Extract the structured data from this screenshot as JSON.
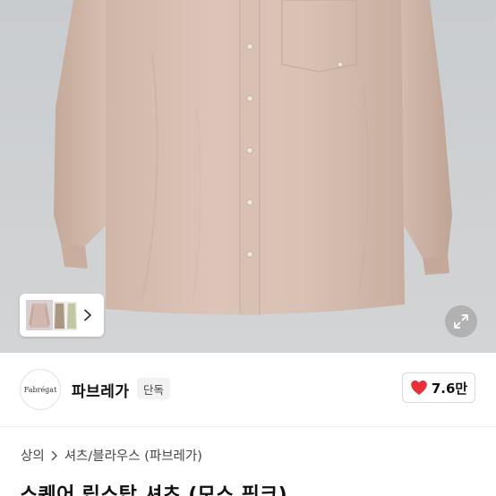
{
  "thumbnails": {
    "next_icon": "chevron-right-icon"
  },
  "expand_icon": "expand-arrows-icon",
  "brand": {
    "logo_text": "Fabrégat",
    "name": "파브레가",
    "badge": "단독"
  },
  "like": {
    "icon": "heart-icon",
    "count": "7.6만",
    "heart_color": "#e8303a"
  },
  "breadcrumb": {
    "items": [
      "상의",
      "셔츠/블라우스 (파브레가)"
    ],
    "separator_icon": "chevron-right-icon"
  },
  "product": {
    "title": "스퀘어 립스탑 셔츠 (모스 핑크)"
  },
  "colors": {
    "shirt": "#d8c1b3",
    "background": "#cdd0d2"
  }
}
